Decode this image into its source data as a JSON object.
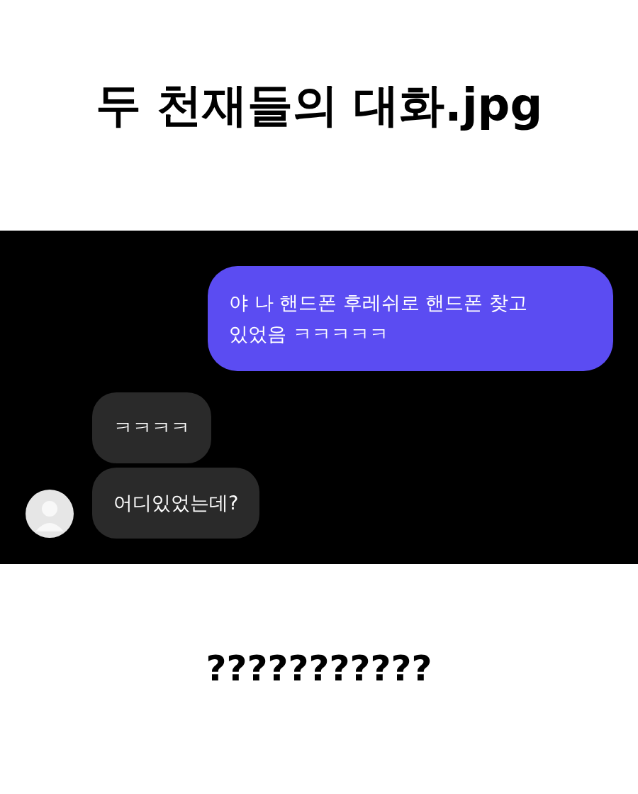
{
  "title": "두 천재들의 대화.jpg",
  "messages": [
    {
      "kind": "sent",
      "text": "야 나 핸드폰 후레쉬로 핸드폰 찾고 있었음 ㅋㅋㅋㅋㅋ"
    },
    {
      "kind": "received",
      "text": "ㅋㅋㅋㅋ",
      "avatar": false
    },
    {
      "kind": "received",
      "text": "어디있었는데?",
      "avatar": true
    }
  ],
  "caption": "???????????"
}
